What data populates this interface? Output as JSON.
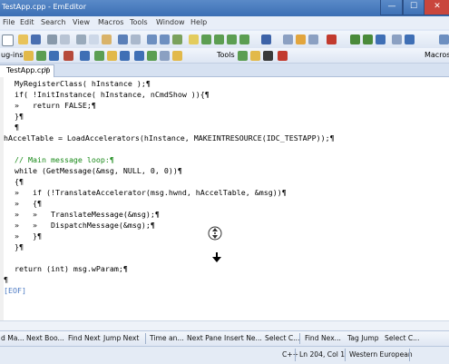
{
  "window": {
    "title": "TestApp.cpp - EmEditor",
    "minimize": "—",
    "maximize": "☐",
    "close": "✕"
  },
  "menu": [
    "File",
    "Edit",
    "Search",
    "View",
    "Macros",
    "Tools",
    "Window",
    "Help"
  ],
  "toolbar2": {
    "plugins_label": "ug-ins",
    "tools_label": "Tools",
    "macros_label": "Macros"
  },
  "tab": {
    "label": "TestApp.cpp",
    "close": "✕"
  },
  "code": [
    "MyRegisterClass( hInstance );¶",
    "if( !InitInstance( hInstance, nCmdShow )){¶",
    "»   return FALSE;¶",
    "}¶",
    "¶",
    "hAccelTable = LoadAccelerators(hInstance, MAKEINTRESOURCE(IDC_TESTAPP));¶",
    "",
    "// Main message loop:¶",
    "while (GetMessage(&msg, NULL, 0, 0))¶",
    "{¶",
    "»   if (!TranslateAccelerator(msg.hwnd, hAccelTable, &msg))¶",
    "»   {¶",
    "»   »   TranslateMessage(&msg);¶",
    "»   »   DispatchMessage(&msg);¶",
    "»   }¶",
    "}¶",
    "",
    "return (int) msg.wParam;¶",
    "¶",
    "[EOF]"
  ],
  "commandbar": [
    "d Ma...",
    "Next Boo...",
    "Find Next",
    "Jump Next",
    "Time an...",
    "Next Pane",
    "Insert Ne...",
    "Select C...",
    "Find Nex...",
    "Tag Jump",
    "Select C..."
  ],
  "status": {
    "lang": "C++",
    "position": "Ln 204, Col 1",
    "encoding": "Western European"
  },
  "colors": {
    "keyword": "#2c5fbf",
    "comment": "#1a8a1a",
    "mark": "#4a78c2",
    "title_bg": "#3b6fb4"
  }
}
